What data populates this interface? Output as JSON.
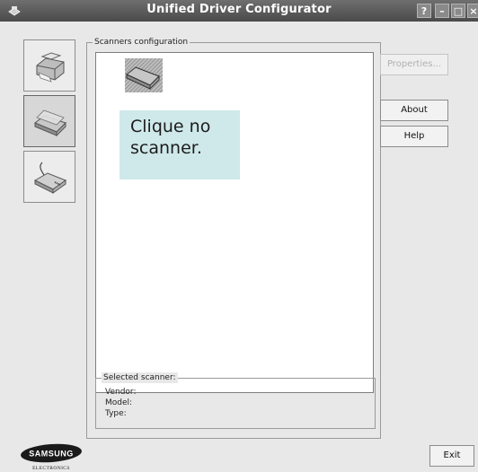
{
  "window": {
    "title": "Unified Driver Configurator"
  },
  "title_controls": {
    "help": "?",
    "minimize": "–",
    "close": "×"
  },
  "sidebar": {
    "items": [
      {
        "name": "printers",
        "icon": "printer-icon"
      },
      {
        "name": "scanners",
        "icon": "scanner-icon",
        "active": true
      },
      {
        "name": "ports",
        "icon": "port-icon"
      }
    ]
  },
  "scanners_group": {
    "label": "Scanners configuration"
  },
  "callout": {
    "text": "Clique no scanner."
  },
  "selected_scanner": {
    "label": "Selected scanner:",
    "vendor": "Vendor:",
    "model": "Model:",
    "type": "Type:"
  },
  "buttons": {
    "properties": "Properties...",
    "about": "About",
    "help": "Help",
    "exit": "Exit"
  },
  "logo": {
    "brand": "SAMSUNG",
    "sub": "ELECTRONICS"
  }
}
